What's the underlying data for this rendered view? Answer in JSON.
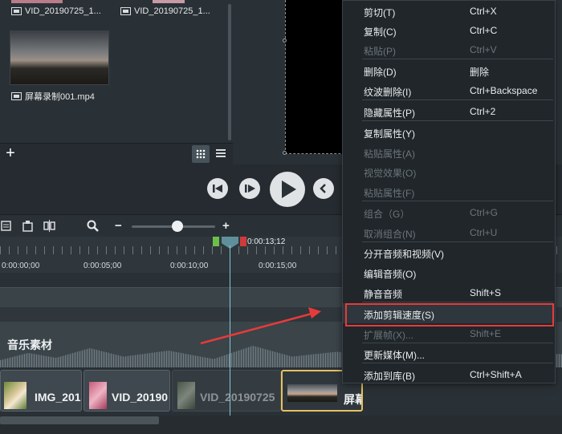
{
  "media_bin": {
    "top_clips": [
      {
        "name": "VID_20190725_1..."
      },
      {
        "name": "VID_20190725_1..."
      }
    ],
    "clip": {
      "name": "屏幕录制001.mp4"
    },
    "add_label": "+"
  },
  "timeline": {
    "playhead_time": "0:00:13;12",
    "ruler": [
      "0:00:00;00",
      "0:00:05;00",
      "0:00:10;00",
      "0:00:15;00"
    ],
    "zoom_minus": "−",
    "zoom_plus": "+",
    "zoom_level": 0.5,
    "music_track_label": "音乐素材",
    "clips": [
      {
        "name": "IMG_201"
      },
      {
        "name": "VID_20190"
      },
      {
        "name": "VID_20190725"
      },
      {
        "name": "屏幕"
      }
    ]
  },
  "context_menu": {
    "items": [
      {
        "label": "剪切(T)",
        "shortcut": "Ctrl+X",
        "enabled": true
      },
      {
        "label": "复制(C)",
        "shortcut": "Ctrl+C",
        "enabled": true
      },
      {
        "label": "粘贴(P)",
        "shortcut": "Ctrl+V",
        "enabled": false
      },
      {
        "label": "删除(D)",
        "shortcut": "删除",
        "enabled": true
      },
      {
        "label": "纹波删除(I)",
        "shortcut": "Ctrl+Backspace",
        "enabled": true
      },
      {
        "label": "隐藏属性(P)",
        "shortcut": "Ctrl+2",
        "enabled": true
      },
      {
        "label": "复制属性(Y)",
        "shortcut": "",
        "enabled": true
      },
      {
        "label": "粘贴属性(A)",
        "shortcut": "",
        "enabled": false
      },
      {
        "label": "视觉效果(O)",
        "shortcut": "",
        "enabled": false
      },
      {
        "label": "粘贴属性(F)",
        "shortcut": "",
        "enabled": false
      },
      {
        "label": "组合（G）",
        "shortcut": "Ctrl+G",
        "enabled": false
      },
      {
        "label": "取消组合(N)",
        "shortcut": "Ctrl+U",
        "enabled": false
      },
      {
        "label": "分开音频和视频(V)",
        "shortcut": "",
        "enabled": true
      },
      {
        "label": "编辑音频(O)",
        "shortcut": "",
        "enabled": true
      },
      {
        "label": "静音音频",
        "shortcut": "Shift+S",
        "enabled": true
      },
      {
        "label": "添加剪辑速度(S)",
        "shortcut": "",
        "enabled": true,
        "highlighted": true
      },
      {
        "label": "扩展帧(X)...",
        "shortcut": "Shift+E",
        "enabled": false
      },
      {
        "label": "更新媒体(M)...",
        "shortcut": "",
        "enabled": true
      },
      {
        "label": "添加到库(B)",
        "shortcut": "Ctrl+Shift+A",
        "enabled": true
      }
    ]
  },
  "colors": {
    "highlight_box": "#e83a3a",
    "selected_clip_border": "#e8c060",
    "playhead": "#86c7d8"
  }
}
